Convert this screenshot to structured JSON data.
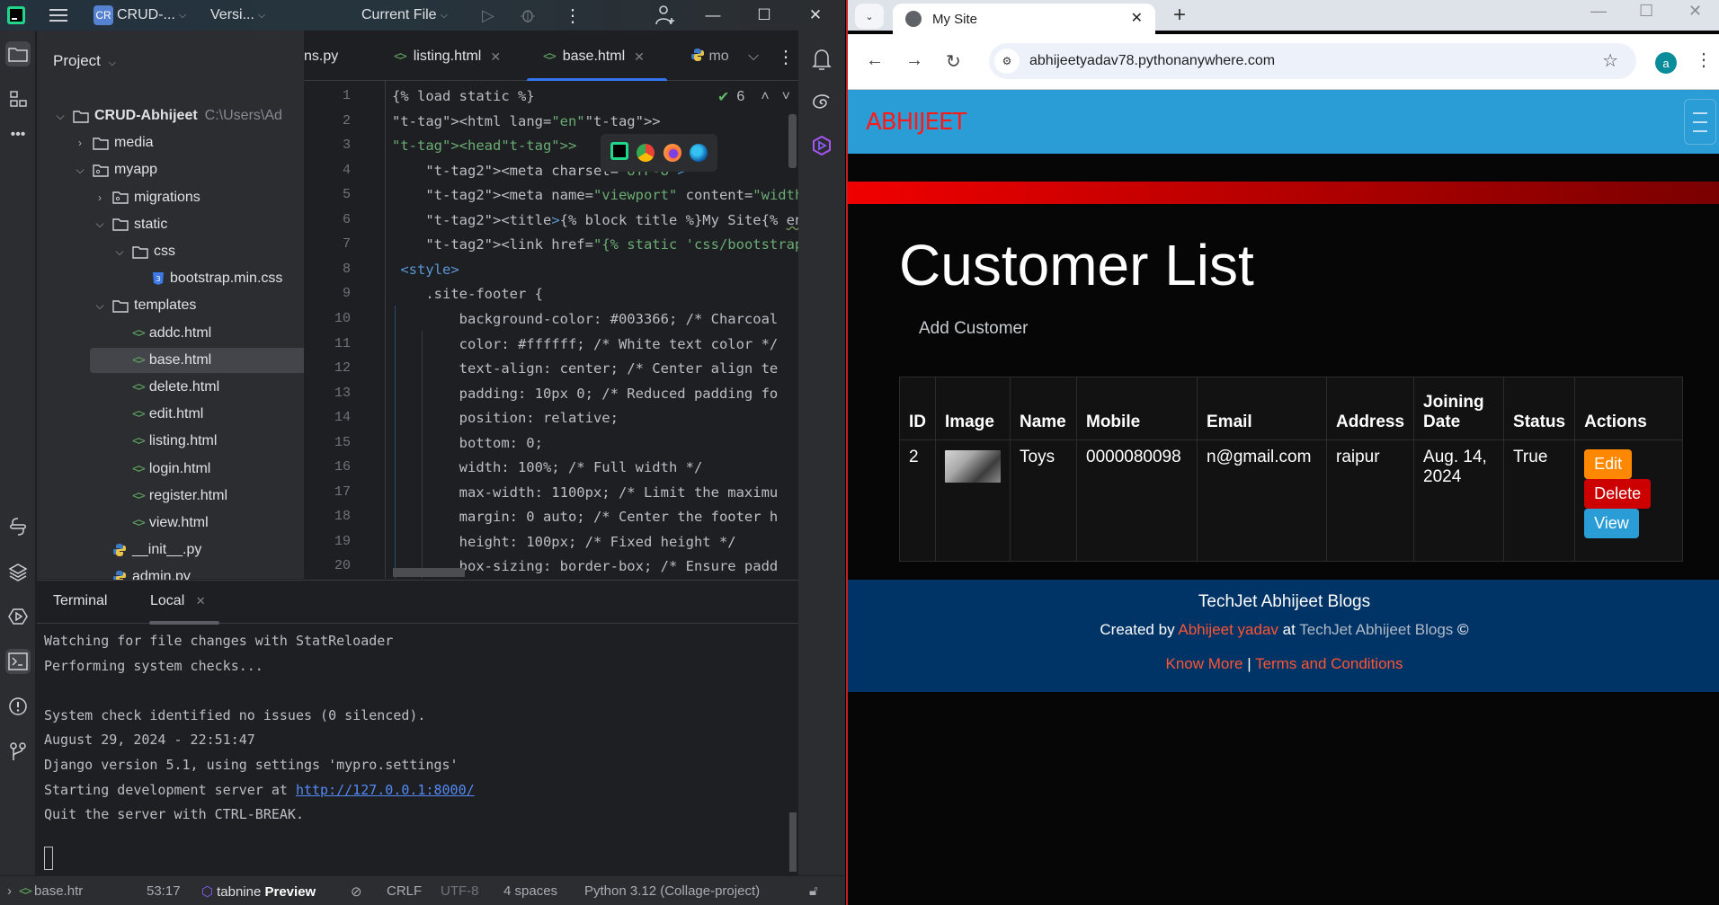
{
  "ide": {
    "title_bar": {
      "project_badge": "CR",
      "project_name": "CRUD-...",
      "vcs": "Versi...",
      "run_config": "Current File"
    },
    "project_panel": {
      "title": "Project",
      "tree": [
        {
          "label": "CRUD-Abhijeet",
          "extra": "C:\\Users\\Ad",
          "type": "folder",
          "expanded": true,
          "depth": 0
        },
        {
          "label": "media",
          "type": "folder",
          "expanded": false,
          "depth": 1
        },
        {
          "label": "myapp",
          "type": "package",
          "expanded": true,
          "depth": 1
        },
        {
          "label": "migrations",
          "type": "package",
          "expanded": false,
          "depth": 2
        },
        {
          "label": "static",
          "type": "folder",
          "expanded": true,
          "depth": 2
        },
        {
          "label": "css",
          "type": "folder",
          "expanded": true,
          "depth": 3
        },
        {
          "label": "bootstrap.min.css",
          "type": "css",
          "depth": 4
        },
        {
          "label": "templates",
          "type": "folder",
          "expanded": true,
          "depth": 2
        },
        {
          "label": "addc.html",
          "type": "html",
          "depth": 3
        },
        {
          "label": "base.html",
          "type": "html",
          "depth": 3,
          "selected": true
        },
        {
          "label": "delete.html",
          "type": "html",
          "depth": 3
        },
        {
          "label": "edit.html",
          "type": "html",
          "depth": 3
        },
        {
          "label": "listing.html",
          "type": "html",
          "depth": 3
        },
        {
          "label": "login.html",
          "type": "html",
          "depth": 3
        },
        {
          "label": "register.html",
          "type": "html",
          "depth": 3
        },
        {
          "label": "view.html",
          "type": "html",
          "depth": 3
        },
        {
          "label": "__init__.py",
          "type": "python",
          "depth": 2
        },
        {
          "label": "admin.py",
          "type": "python",
          "depth": 2
        }
      ]
    },
    "editor_tabs": [
      {
        "label": "ns.py",
        "icon": "python-icon",
        "active": false
      },
      {
        "label": "listing.html",
        "icon": "html-icon",
        "active": false
      },
      {
        "label": "base.html",
        "icon": "html-icon",
        "active": true
      },
      {
        "label": "mo",
        "icon": "python-icon",
        "active": false
      }
    ],
    "inspection_count": "6",
    "code_lines": [
      {
        "n": "1",
        "text": "{% load static %}"
      },
      {
        "n": "2",
        "text": "<html lang=\"en\">"
      },
      {
        "n": "3",
        "text": "<head>"
      },
      {
        "n": "4",
        "text": "    <meta charset=\"UTF-8\">"
      },
      {
        "n": "5",
        "text": "    <meta name=\"viewport\" content=\"width=devi"
      },
      {
        "n": "6",
        "text": "    <title>{% block title %}My Site{% endblock"
      },
      {
        "n": "7",
        "text": "    <link href=\"{% static 'css/bootstrap.min.c"
      },
      {
        "n": "8",
        "text": " <style>"
      },
      {
        "n": "9",
        "text": "    .site-footer {"
      },
      {
        "n": "10",
        "text": "        background-color: #003366; /* Charcoal"
      },
      {
        "n": "11",
        "text": "        color: #ffffff; /* White text color */"
      },
      {
        "n": "12",
        "text": "        text-align: center; /* Center align te"
      },
      {
        "n": "13",
        "text": "        padding: 10px 0; /* Reduced padding fo"
      },
      {
        "n": "14",
        "text": "        position: relative;"
      },
      {
        "n": "15",
        "text": "        bottom: 0;"
      },
      {
        "n": "16",
        "text": "        width: 100%; /* Full width */"
      },
      {
        "n": "17",
        "text": "        max-width: 1100px; /* Limit the maximu"
      },
      {
        "n": "18",
        "text": "        margin: 0 auto; /* Center the footer h"
      },
      {
        "n": "19",
        "text": "        height: 100px; /* Fixed height */"
      },
      {
        "n": "20",
        "text": "        box-sizing: border-box; /* Ensure padd"
      }
    ],
    "terminal": {
      "title": "Terminal",
      "tab": "Local",
      "lines": [
        "Watching for file changes with StatReloader",
        "Performing system checks...",
        "",
        "System check identified no issues (0 silenced).",
        "August 29, 2024 - 22:51:47",
        "Django version 5.1, using settings 'mypro.settings'",
        "Starting development server at ",
        "Quit the server with CTRL-BREAK."
      ],
      "server_url": "http://127.0.0.1:8000/"
    },
    "status_bar": {
      "breadcrumb": "base.htr",
      "position": "53:17",
      "plugin_name": "tabnine",
      "plugin_tag": "Preview",
      "line_ending": "CRLF",
      "encoding": "UTF-8",
      "indent": "4 spaces",
      "interpreter": "Python 3.12 (Collage-project)"
    }
  },
  "browser": {
    "tab_title": "My Site",
    "url": "abhijeetyadav78.pythonanywhere.com",
    "profile_initial": "a",
    "site": {
      "brand": "ABHIJEET",
      "page_title": "Customer List",
      "add_link": "Add Customer",
      "table": {
        "headers": [
          "ID",
          "Image",
          "Name",
          "Mobile",
          "Email",
          "Address",
          "Joining Date",
          "Status",
          "Actions"
        ],
        "rows": [
          {
            "id": "2",
            "name": "Toys",
            "mobile": "0000080098",
            "email": "n@gmail.com",
            "address": "raipur",
            "joining_date": "Aug. 14, 2024",
            "status": "True"
          }
        ],
        "actions": {
          "edit": "Edit",
          "delete": "Delete",
          "view": "View"
        }
      },
      "footer": {
        "title": "TechJet Abhijeet Blogs",
        "created_prefix": "Created by",
        "author": "Abhijeet yadav",
        "at": "at",
        "org": "TechJet Abhijeet Blogs",
        "copyright": "©",
        "know_more": "Know More",
        "separator": "|",
        "terms": "Terms and Conditions"
      },
      "colors": {
        "navbar": "#2a9dd6",
        "brand": "#ff1a1a",
        "footer": "#003366",
        "edit": "#ff8800",
        "delete": "#cc0000",
        "view": "#2a9dd6"
      }
    }
  }
}
